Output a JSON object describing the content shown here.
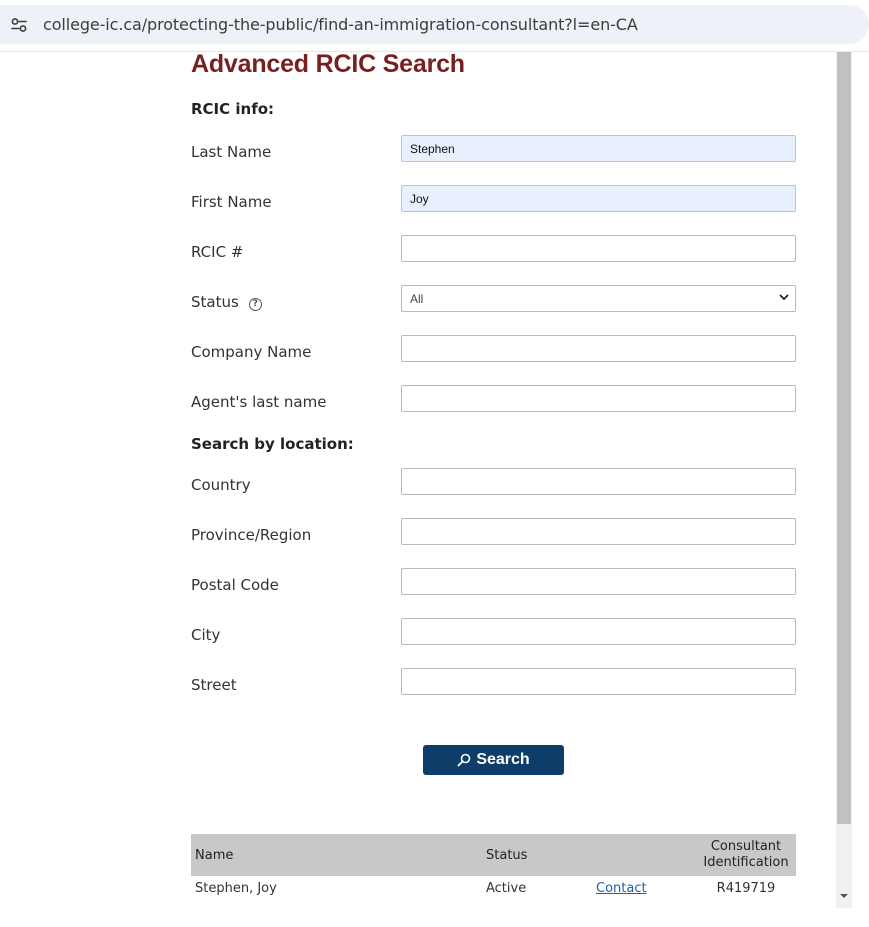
{
  "browser": {
    "url": "college-ic.ca/protecting-the-public/find-an-immigration-consultant?l=en-CA"
  },
  "page": {
    "title": "Advanced RCIC Search",
    "section_rcic": "RCIC info:",
    "section_location": "Search by location:"
  },
  "fields": {
    "last_name": {
      "label": "Last Name",
      "value": "Stephen"
    },
    "first_name": {
      "label": "First Name",
      "value": "Joy"
    },
    "rcic_number": {
      "label": "RCIC #",
      "value": ""
    },
    "status": {
      "label": "Status",
      "value": "All",
      "help_icon": "question-circle-icon"
    },
    "company_name": {
      "label": "Company Name",
      "value": ""
    },
    "agent_last_name": {
      "label": "Agent's last name",
      "value": ""
    },
    "country": {
      "label": "Country",
      "value": ""
    },
    "province": {
      "label": "Province/Region",
      "value": ""
    },
    "postal_code": {
      "label": "Postal Code",
      "value": ""
    },
    "city": {
      "label": "City",
      "value": ""
    },
    "street": {
      "label": "Street",
      "value": ""
    }
  },
  "search_button": {
    "label": "Search",
    "icon": "search-icon",
    "color": "#0e3d6a"
  },
  "results": {
    "headers": {
      "name": "Name",
      "status": "Status",
      "contact": "",
      "consultant_id_line1": "Consultant",
      "consultant_id_line2": "Identification"
    },
    "rows": [
      {
        "name": "Stephen, Joy",
        "status": "Active",
        "contact": "Contact",
        "consultant_id": "R419719"
      }
    ]
  },
  "colors": {
    "title": "#7a1f1f",
    "button": "#0e3d6a",
    "table_header": "#c8c8c8",
    "autofill": "#e8f0fe"
  }
}
